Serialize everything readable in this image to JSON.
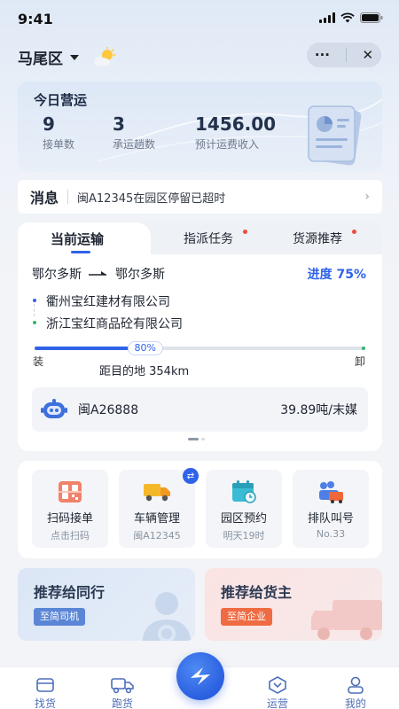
{
  "status_bar": {
    "time": "9:41"
  },
  "header": {
    "location": "马尾区",
    "more_label": "···",
    "close_label": "✕"
  },
  "ops": {
    "title": "今日营运",
    "stats": [
      {
        "value": "9",
        "label": "接单数"
      },
      {
        "value": "3",
        "label": "承运趟数"
      },
      {
        "value": "1456.00",
        "label": "预计运费收入"
      }
    ]
  },
  "message": {
    "label": "消息",
    "text": "闽A12345在园区停留已超时",
    "arrow": "›"
  },
  "tabs": [
    {
      "label": "当前运输",
      "active": true,
      "dot": false
    },
    {
      "label": "指派任务",
      "active": false,
      "dot": true
    },
    {
      "label": "货源推荐",
      "active": false,
      "dot": true
    }
  ],
  "transport": {
    "from": "鄂尔多斯",
    "to": "鄂尔多斯",
    "progress_label": "进度 75%",
    "progress": 0.8,
    "progress_badge": "80%",
    "shipper": "衢州宝红建材有限公司",
    "receiver": "浙江宝红商品砼有限公司",
    "load_label": "装",
    "unload_label": "卸",
    "distance": "距目的地 354km",
    "plate": "闽A26888",
    "cargo": "39.89吨/末媒"
  },
  "services": [
    {
      "label": "扫码接单",
      "sub": "点击扫码",
      "icon": "qr-scan-icon"
    },
    {
      "label": "车辆管理",
      "sub": "闽A12345",
      "icon": "truck-icon"
    },
    {
      "label": "园区预约",
      "sub": "明天19时",
      "icon": "calendar-icon"
    },
    {
      "label": "排队叫号",
      "sub": "No.33",
      "icon": "queue-icon"
    }
  ],
  "recommend": [
    {
      "title": "推荐给同行",
      "button": "至简司机"
    },
    {
      "title": "推荐给货主",
      "button": "至简企业"
    }
  ],
  "tabbar": [
    {
      "label": "找货",
      "icon": "find-goods-icon"
    },
    {
      "label": "跑货",
      "icon": "run-goods-icon"
    },
    {
      "label": "运营",
      "icon": "operation-icon"
    },
    {
      "label": "我的",
      "icon": "profile-icon"
    }
  ],
  "colors": {
    "primary": "#2f63e8",
    "danger": "#ef4c3c",
    "orange": "#f0683a"
  }
}
